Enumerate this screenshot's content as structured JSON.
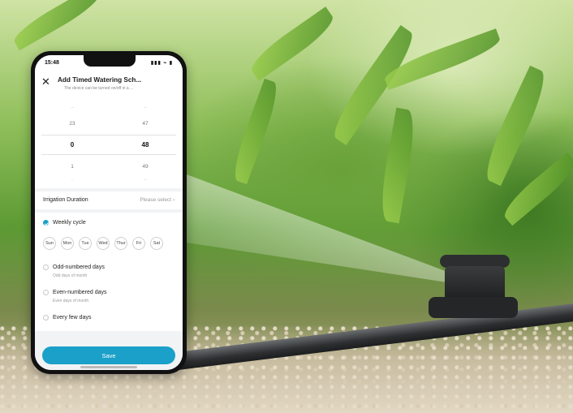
{
  "status_bar": {
    "time": "15:48",
    "indicators": "▮▮▮ ⌁ ▮"
  },
  "header": {
    "close_icon": "✕",
    "title": "Add Timed Watering Sch...",
    "subtitle": "The device can be turned on/off in a ..."
  },
  "picker": {
    "rows": [
      {
        "hour": "--",
        "minute": "--"
      },
      {
        "hour": "23",
        "minute": "47"
      },
      {
        "hour": "0",
        "minute": "48"
      },
      {
        "hour": "1",
        "minute": "49"
      },
      {
        "hour": "-",
        "minute": "--"
      }
    ]
  },
  "duration": {
    "label": "Irrigation Duration",
    "value": "Please select",
    "chevron": "›"
  },
  "cycle": {
    "weekly": {
      "label": "Weekly cycle",
      "selected": true
    },
    "days": [
      "Sun",
      "Mon",
      "Tue",
      "Wed",
      "Thur",
      "Fri",
      "Sat"
    ],
    "odd": {
      "label": "Odd-numbered days",
      "sub": "Odd days of month"
    },
    "even": {
      "label": "Even-numbered days",
      "sub": "Even days of month"
    },
    "few": {
      "label": "Every few days"
    }
  },
  "save_label": "Save",
  "colors": {
    "accent": "#1aa0c9"
  }
}
